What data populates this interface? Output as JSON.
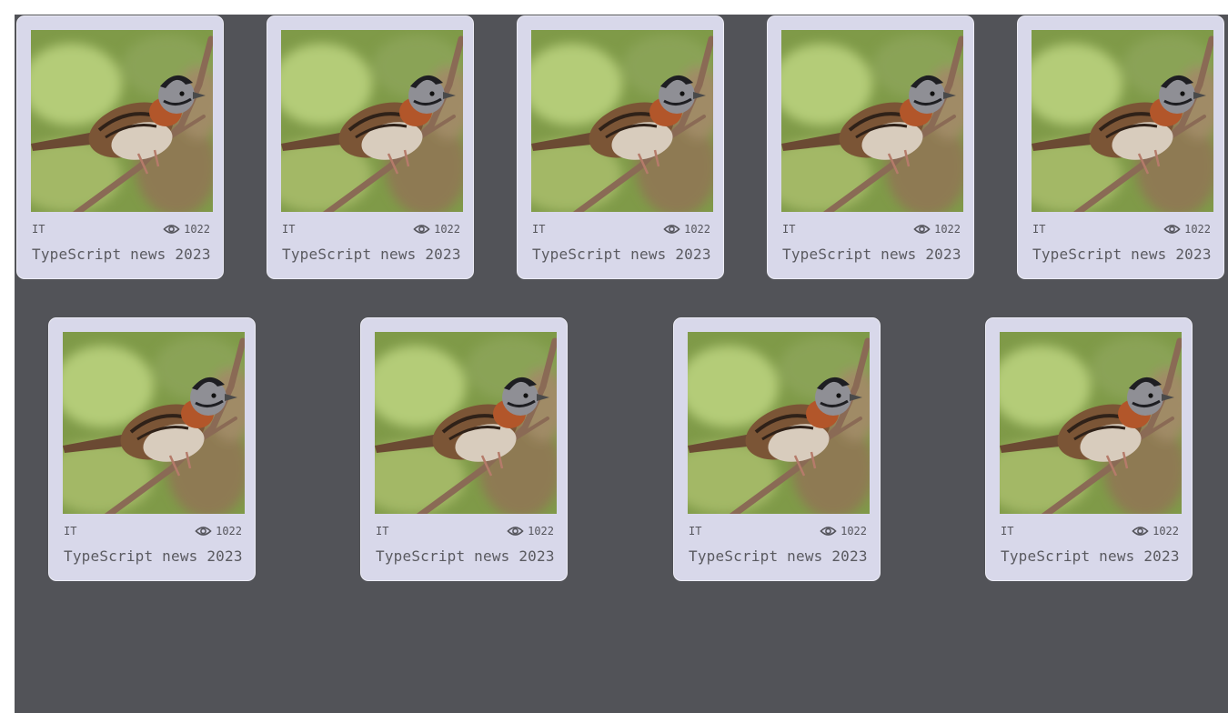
{
  "cards": [
    {
      "category": "IT",
      "views": "1022",
      "title": "TypeScript news 2023"
    },
    {
      "category": "IT",
      "views": "1022",
      "title": "TypeScript news 2023"
    },
    {
      "category": "IT",
      "views": "1022",
      "title": "TypeScript news 2023"
    },
    {
      "category": "IT",
      "views": "1022",
      "title": "TypeScript news 2023"
    },
    {
      "category": "IT",
      "views": "1022",
      "title": "TypeScript news 2023"
    },
    {
      "category": "IT",
      "views": "1022",
      "title": "TypeScript news 2023"
    },
    {
      "category": "IT",
      "views": "1022",
      "title": "TypeScript news 2023"
    },
    {
      "category": "IT",
      "views": "1022",
      "title": "TypeScript news 2023"
    },
    {
      "category": "IT",
      "views": "1022",
      "title": "TypeScript news 2023"
    }
  ],
  "image": {
    "subject": "sparrow-on-branch-photo"
  },
  "icons": {
    "views": "eye-icon"
  },
  "colors": {
    "background": "#525358",
    "card": "#d8d8ea",
    "text": "#55555c"
  }
}
